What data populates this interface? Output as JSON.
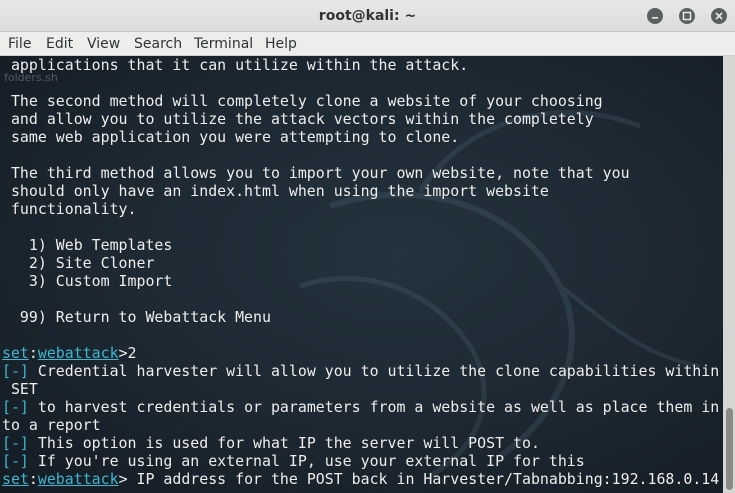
{
  "window": {
    "title": "root@kali: ~"
  },
  "menubar": {
    "items": [
      "File",
      "Edit",
      "View",
      "Search",
      "Terminal",
      "Help"
    ]
  },
  "terminal": {
    "background_text": "folders.sh",
    "lines": [
      " applications that it can utilize within the attack.",
      "",
      " The second method will completely clone a website of your choosing",
      " and allow you to utilize the attack vectors within the completely",
      " same web application you were attempting to clone.",
      "",
      " The third method allows you to import your own website, note that you",
      " should only have an index.html when using the import website",
      " functionality.",
      "",
      "   1) Web Templates",
      "   2) Site Cloner",
      "   3) Custom Import",
      "",
      "  99) Return to Webattack Menu",
      "",
      "",
      "",
      "",
      "",
      "",
      "",
      ""
    ],
    "prompt": {
      "set": "set",
      "module": "webattack",
      "input": "2"
    },
    "info_lines": [
      {
        "marker": "[-]",
        "text": " Credential harvester will allow you to utilize the clone capabilities within"
      },
      {
        "marker": "",
        "text": " SET"
      },
      {
        "marker": "[-]",
        "text": " to harvest credentials or parameters from a website as well as place them in"
      },
      {
        "marker": "",
        "text": "to a report"
      },
      {
        "marker": "[-]",
        "text": " This option is used for what IP the server will POST to."
      },
      {
        "marker": "[-]",
        "text": " If you're using an external IP, use your external IP for this"
      }
    ],
    "final_prompt": {
      "set": "set",
      "module": "webattack",
      "text": "> IP address for the POST back in Harvester/Tabnabbing:192.168.0.14"
    }
  },
  "colors": {
    "prompt_cyan": "#3fb6cf",
    "foreground": "#eeeeec",
    "background": "#1b2630"
  },
  "scroll": {
    "position_fraction": 1.0
  }
}
